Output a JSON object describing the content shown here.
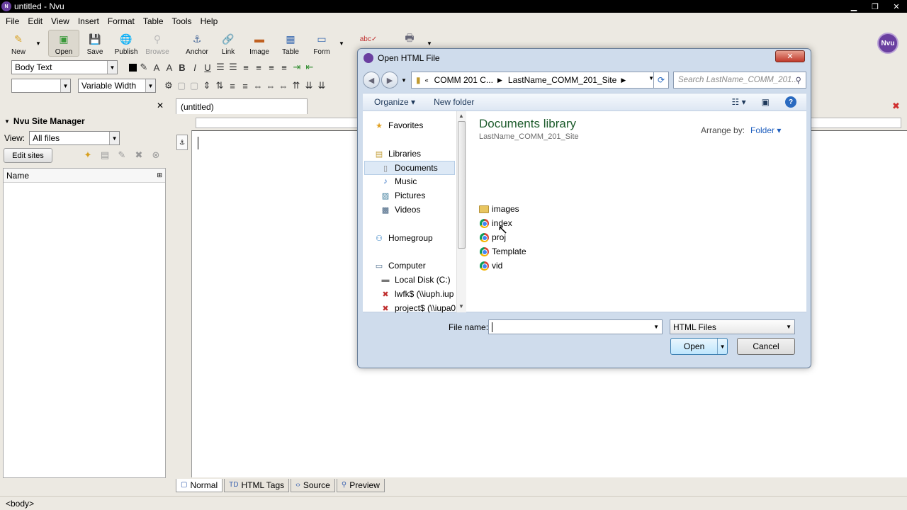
{
  "window": {
    "title": "untitled - Nvu",
    "logo": "Nvu"
  },
  "menu": [
    "File",
    "Edit",
    "View",
    "Insert",
    "Format",
    "Table",
    "Tools",
    "Help"
  ],
  "toolbar": {
    "new": "New",
    "open": "Open",
    "save": "Save",
    "publish": "Publish",
    "browse": "Browse",
    "anchor": "Anchor",
    "link": "Link",
    "image": "Image",
    "table": "Table",
    "form": "Form"
  },
  "format_toolbar": {
    "paragraph_style": "Body Text",
    "width_mode": "Variable Width"
  },
  "site_manager": {
    "title": "Nvu Site Manager",
    "view_label": "View:",
    "view_value": "All files",
    "edit_sites": "Edit sites",
    "column_name": "Name"
  },
  "editor": {
    "tab_title": "(untitled)",
    "modes": [
      "Normal",
      "HTML Tags",
      "Source",
      "Preview"
    ]
  },
  "status_bar": {
    "text": "<body>"
  },
  "dialog": {
    "title": "Open HTML File",
    "breadcrumb": [
      "COMM 201 C...",
      "LastName_COMM_201_Site"
    ],
    "search_placeholder": "Search LastName_COMM_201...",
    "organize": "Organize",
    "new_folder": "New folder",
    "nav": {
      "favorites": "Favorites",
      "libraries": "Libraries",
      "documents": "Documents",
      "music": "Music",
      "pictures": "Pictures",
      "videos": "Videos",
      "homegroup": "Homegroup",
      "computer": "Computer",
      "local_disk": "Local Disk (C:)",
      "drive1": "lwfk$ (\\\\iuph.iup",
      "drive2": "project$ (\\\\iupa0"
    },
    "library_title": "Documents library",
    "library_subtitle": "LastName_COMM_201_Site",
    "arrange_by_label": "Arrange by:",
    "arrange_by_value": "Folder",
    "files": [
      {
        "name": "images",
        "kind": "folder"
      },
      {
        "name": "index",
        "kind": "chrome"
      },
      {
        "name": "proj",
        "kind": "chrome"
      },
      {
        "name": "Template",
        "kind": "chrome"
      },
      {
        "name": "vid",
        "kind": "chrome"
      }
    ],
    "file_name_label": "File name:",
    "file_name_value": "",
    "file_type": "HTML Files",
    "open_button": "Open",
    "cancel_button": "Cancel"
  }
}
